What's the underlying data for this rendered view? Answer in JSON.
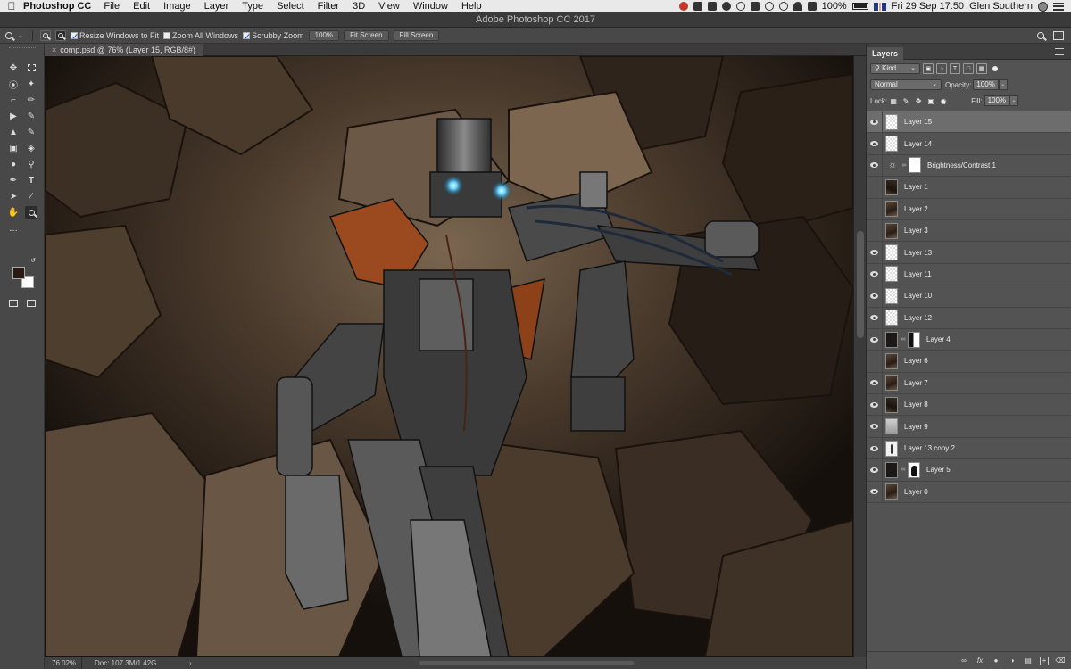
{
  "menubar": {
    "app_name": "Photoshop CC",
    "items": [
      "File",
      "Edit",
      "Image",
      "Layer",
      "Type",
      "Select",
      "Filter",
      "3D",
      "View",
      "Window",
      "Help"
    ],
    "battery": "100%",
    "date_time": "Fri 29 Sep  17:50",
    "user": "Glen Southern"
  },
  "window": {
    "title": "Adobe Photoshop CC 2017"
  },
  "options": {
    "resize_windows": "Resize Windows to Fit",
    "zoom_all": "Zoom All Windows",
    "scrubby_zoom": "Scrubby Zoom",
    "zoom_100": "100%",
    "fit_screen": "Fit Screen",
    "fill_screen": "Fill Screen"
  },
  "document": {
    "tab_title": "comp.psd @ 76% (Layer 15, RGB/8#)"
  },
  "status": {
    "zoom": "76.02%",
    "doc_size": "Doc: 107.3M/1.42G"
  },
  "layers_panel": {
    "tab": "Layers",
    "filter_kind": "Kind",
    "blend_mode": "Normal",
    "opacity_label": "Opacity:",
    "opacity": "100%",
    "lock_label": "Lock:",
    "fill_label": "Fill:",
    "fill": "100%",
    "layers": [
      {
        "name": "Layer 15",
        "visible": true,
        "selected": true
      },
      {
        "name": "Layer 14",
        "visible": true
      },
      {
        "name": "Brightness/Contrast 1",
        "visible": true
      },
      {
        "name": "Layer 1",
        "visible": false
      },
      {
        "name": "Layer 2",
        "visible": false
      },
      {
        "name": "Layer 3",
        "visible": false
      },
      {
        "name": "Layer 13",
        "visible": true
      },
      {
        "name": "Layer 11",
        "visible": true
      },
      {
        "name": "Layer 10",
        "visible": true
      },
      {
        "name": "Layer 12",
        "visible": true
      },
      {
        "name": "Layer 4",
        "visible": true
      },
      {
        "name": "Layer 6",
        "visible": false
      },
      {
        "name": "Layer 7",
        "visible": true
      },
      {
        "name": "Layer 8",
        "visible": true
      },
      {
        "name": "Layer 9",
        "visible": true
      },
      {
        "name": "Layer 13 copy 2",
        "visible": true
      },
      {
        "name": "Layer 5",
        "visible": true
      },
      {
        "name": "Layer 0",
        "visible": true
      }
    ]
  }
}
